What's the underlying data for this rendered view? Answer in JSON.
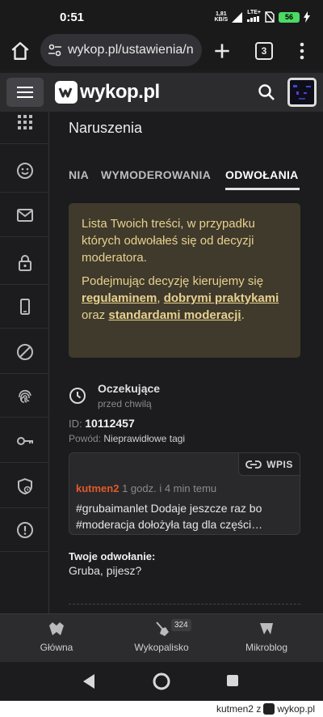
{
  "status_bar": {
    "time": "0:51",
    "net_speed_value": "1,81",
    "net_speed_unit": "KB/S",
    "network": "LTE+",
    "battery": "56"
  },
  "browser": {
    "url": "wykop.pl/ustawienia/n",
    "tab_count": "3"
  },
  "site": {
    "logo_text": "wykop.pl"
  },
  "main": {
    "title": "Naruszenia",
    "tabs": [
      {
        "label": "NIA"
      },
      {
        "label": "WYMODEROWANIA"
      },
      {
        "label": "ODWOŁANIA"
      }
    ],
    "active_tab": 2,
    "notice": {
      "p1": "Lista Twoich treści, w przypadku których odwołałeś się od decyzji moderatora.",
      "p2_before": "Podejmując decyzję kierujemy się ",
      "link1": "regulaminem",
      "sep1": ", ",
      "link2": "dobrymi praktykami",
      "sep2": " oraz ",
      "link3": "standardami moderacji",
      "end": "."
    },
    "appeal": {
      "status": "Oczekujące",
      "time": "przed chwilą",
      "id_label": "ID: ",
      "id_value": "10112457",
      "reason_label": "Powód: ",
      "reason_value": "Nieprawidłowe tagi",
      "entry": {
        "badge": "WPIS",
        "author": "kutmen2",
        "time": " 1 godz. i 4 min temu",
        "text": "#grubaimanlet Dodaje jeszcze raz bo #moderacja dołożyła tag dla części…"
      },
      "your_appeal_label": "Twoje odwołanie:",
      "your_appeal_text": "Gruba, pijesz?"
    }
  },
  "bottom_nav": [
    {
      "label": "Główna"
    },
    {
      "label": "Wykopalisko",
      "badge": "324"
    },
    {
      "label": "Mikroblog"
    }
  ],
  "watermark": {
    "text": "kutmen2  z",
    "brand": "wykop.pl"
  },
  "colors": {
    "background": "#1c1c1e",
    "notice_bg": "#403a2c",
    "notice_text": "#e7d18f",
    "author": "#e05a2b"
  }
}
